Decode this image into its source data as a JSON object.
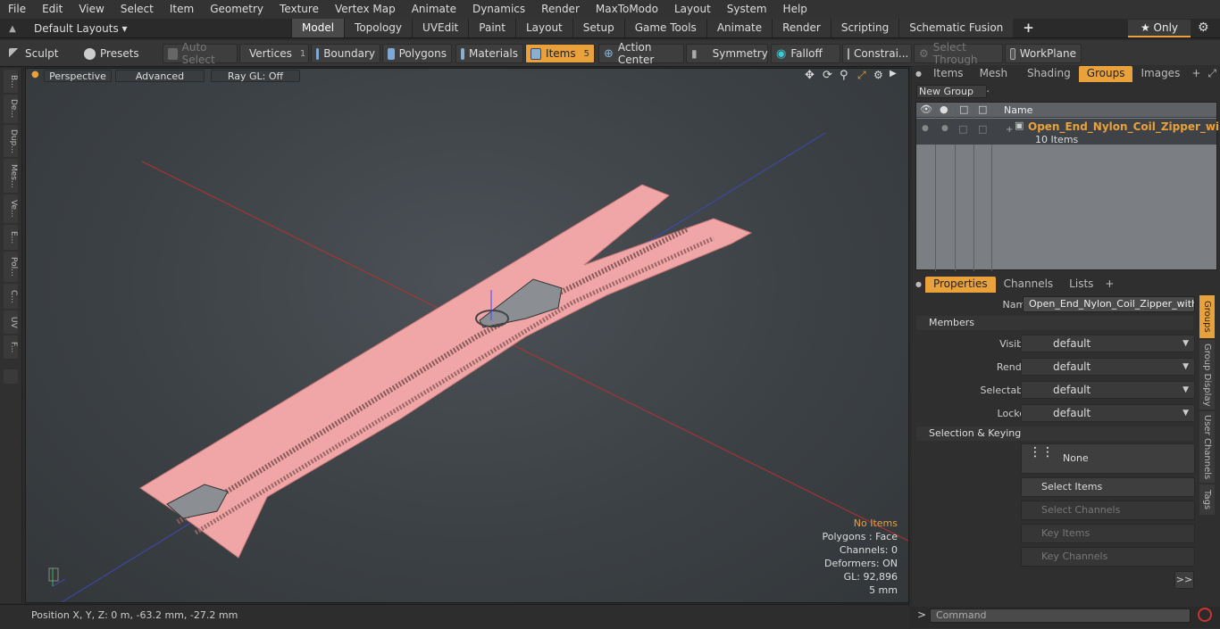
{
  "menu": [
    "File",
    "Edit",
    "View",
    "Select",
    "Item",
    "Geometry",
    "Texture",
    "Vertex Map",
    "Animate",
    "Dynamics",
    "Render",
    "MaxToModo",
    "Layout",
    "System",
    "Help"
  ],
  "layouts": {
    "label": "Default Layouts ▾"
  },
  "modeTabs": [
    "Model",
    "Topology",
    "UVEdit",
    "Paint",
    "Layout",
    "Setup",
    "Game Tools",
    "Animate",
    "Render",
    "Scripting",
    "Schematic Fusion"
  ],
  "only": "★ Only",
  "toolbar": {
    "sculpt": "Sculpt",
    "presets": "Presets",
    "autoselect": "Auto Select",
    "vertices": "Vertices",
    "vertices_count": "1",
    "boundary": "Boundary",
    "polygons": "Polygons",
    "materials": "Materials",
    "items": "Items",
    "items_count": "5",
    "action_center": "Action Center",
    "symmetry": "Symmetry",
    "falloff": "Falloff",
    "constraints": "Constrai...",
    "select_through": "Select Through",
    "workplane": "WorkPlane"
  },
  "leftTabs": [
    "B...",
    "De...",
    "Dup...",
    "Mes...",
    "Ve...",
    "E...",
    "Pol...",
    "C...",
    "UV",
    "F..."
  ],
  "viewport": {
    "perspective": "Perspective",
    "advanced": "Advanced",
    "raygl": "Ray GL: Off",
    "info_noitems": "No Items",
    "info_polygons": "Polygons : Face",
    "info_channels": "Channels: 0",
    "info_deformers": "Deformers: ON",
    "info_gl": "GL: 92,896",
    "info_scale": "5 mm"
  },
  "status": {
    "position": "Position X, Y, Z:   0 m, -63.2 mm, -27.2 mm"
  },
  "rightTabs": [
    "Items",
    "Mesh ...",
    "Shading",
    "Groups",
    "Images"
  ],
  "groups": {
    "new_group": "New Group",
    "col_name": "Name",
    "group_name": "Open_End_Nylon_Coil_Zipper_wi...",
    "group_count": "10 Items"
  },
  "propTabs": [
    "Properties",
    "Channels",
    "Lists"
  ],
  "props": {
    "name_label": "Name",
    "name_value": "Open_End_Nylon_Coil_Zipper_with_Sl",
    "members": "Members",
    "visible_label": "Visible",
    "render_label": "Render",
    "selectable_label": "Selectable",
    "locked_label": "Locked",
    "default_value": "default",
    "selkey": "Selection & Keying",
    "none": "None",
    "select_items": "Select Items",
    "select_channels": "Select Channels",
    "key_items": "Key Items",
    "key_channels": "Key Channels",
    "more": ">>"
  },
  "sideTabs": [
    "Groups",
    "Group Display",
    "User Channels",
    "Tags"
  ],
  "command": {
    "placeholder": "Command"
  }
}
